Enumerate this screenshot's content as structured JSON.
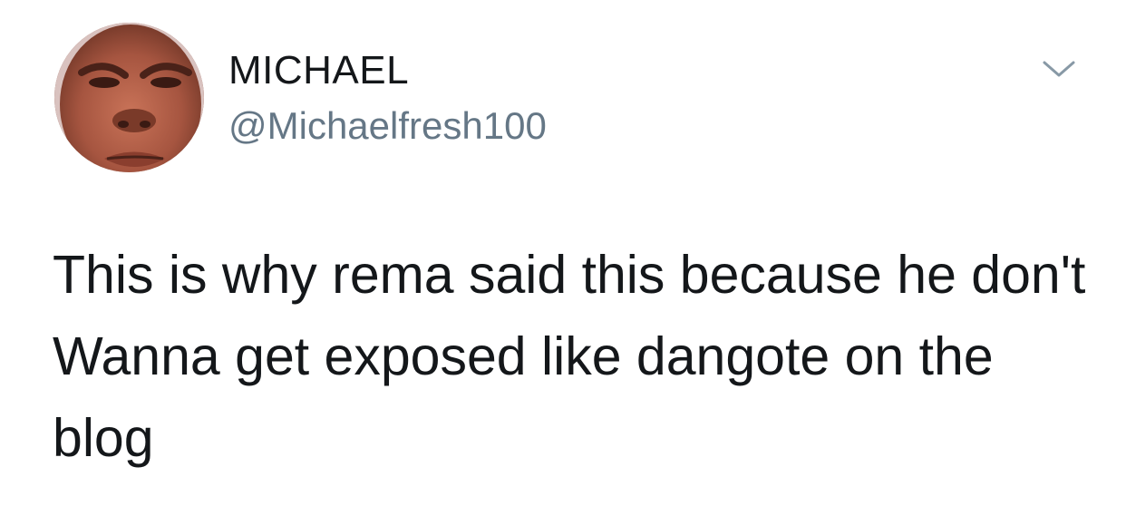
{
  "tweet": {
    "author": {
      "display_name": "MICHAEL",
      "handle": "@Michaelfresh100",
      "avatar_icon": "profile-photo"
    },
    "menu_icon": "chevron-down-icon",
    "text": "This is why rema said this because he don't Wanna get exposed like dangote on the blog",
    "colors": {
      "text": "#14171a",
      "secondary": "#657786",
      "chevron": "#8899a6",
      "background": "#ffffff"
    }
  }
}
